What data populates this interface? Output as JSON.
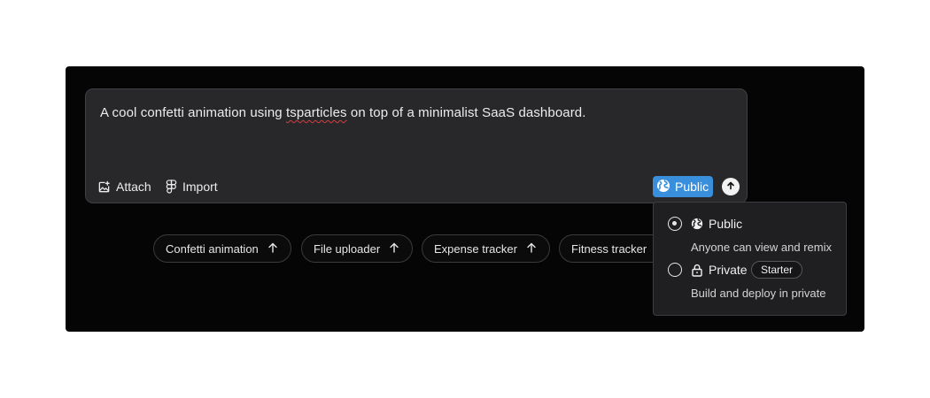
{
  "prompt": {
    "text_before": "A cool confetti animation using ",
    "text_misspelled": "tsparticles",
    "text_after": " on top of a minimalist SaaS dashboard."
  },
  "toolbar": {
    "attach_label": "Attach",
    "attach_icon": "image-plus-icon",
    "import_label": "Import",
    "import_icon": "figma-icon",
    "visibility_label": "Public",
    "visibility_icon": "globe-icon",
    "send_icon": "arrow-up-icon"
  },
  "suggestions": [
    {
      "label": "Confetti animation"
    },
    {
      "label": "File uploader"
    },
    {
      "label": "Expense tracker"
    },
    {
      "label": "Fitness tracker"
    }
  ],
  "visibility_menu": {
    "public": {
      "title": "Public",
      "description": "Anyone can view and remix",
      "selected": true
    },
    "private": {
      "title": "Private",
      "badge": "Starter",
      "description": "Build and deploy in private",
      "selected": false
    }
  },
  "colors": {
    "panel_bg": "#050506",
    "input_bg": "#28282b",
    "accent": "#3a8fdc"
  }
}
